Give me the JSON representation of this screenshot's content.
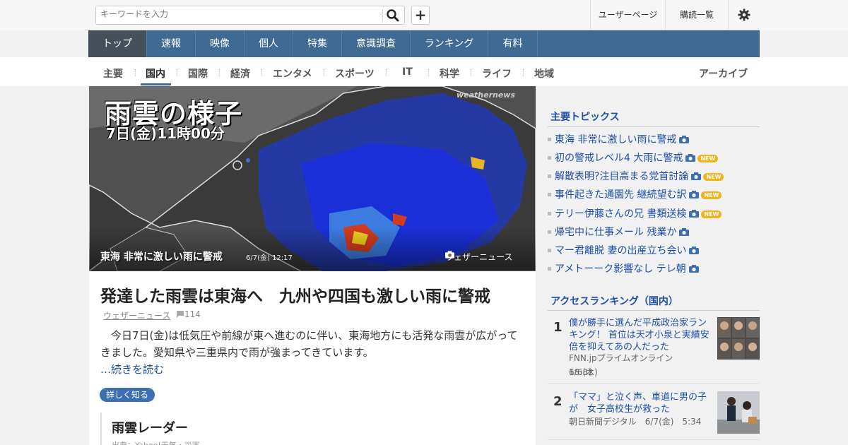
{
  "search": {
    "placeholder": "キーワードを入力",
    "add_label": "+"
  },
  "toplinks": {
    "user_page": "ユーザーページ",
    "subscriptions": "購読一覧"
  },
  "main_nav": [
    "トップ",
    "速報",
    "映像",
    "個人",
    "特集",
    "意識調査",
    "ランキング",
    "有料"
  ],
  "sub_nav": [
    "主要",
    "国内",
    "国際",
    "経済",
    "エンタメ",
    "スポーツ",
    "IT",
    "科学",
    "ライフ",
    "地域"
  ],
  "archive_label": "アーカイブ",
  "hero": {
    "image_title": "雨雲の様子",
    "image_subtitle": "7日(金)11時00分",
    "watermark": "weathernews",
    "caption": "東海 非常に激しい雨に警戒",
    "time": "6/7(金) 12:17",
    "credit": "ウェザーニュース"
  },
  "article": {
    "headline": "発達した雨雲は東海へ　九州や四国も激しい雨に警戒",
    "source": "ウェザーニュース",
    "comments": "114",
    "body_line1": "今日7日(金)は低気圧や前線が東へ進むのに伴い、東海地方にも活発な雨雲が広がって",
    "body_line2": "きました。愛知県や三重県内で雨が強まってきています。",
    "read_more": "…続きを読む",
    "learn_more": "詳しく知る",
    "radar_title": "雨雲レーダー",
    "radar_source": "出典：Yahoo!天気・災害"
  },
  "topics": {
    "title": "主要トピックス",
    "items": [
      {
        "text": "東海 非常に激しい雨に警戒",
        "new": false
      },
      {
        "text": "初の警戒レベル4 大雨に警戒",
        "new": true
      },
      {
        "text": "解散表明?注目高まる党首討論",
        "new": true
      },
      {
        "text": "事件起きた通園先 継続望む訳",
        "new": true
      },
      {
        "text": "テリー伊藤さんの兄 書類送検",
        "new": true
      },
      {
        "text": "帰宅中に仕事メール 残業か",
        "new": false
      },
      {
        "text": "マー君離脱 妻の出産立ち会い",
        "new": false
      },
      {
        "text": "アメトーーク影響なし テレ朝",
        "new": false
      }
    ],
    "new_label": "NEW"
  },
  "ranking": {
    "title": "アクセスランキング（国内）",
    "items": [
      {
        "rank": "1",
        "title": "僕が勝手に選んだ平成政治家ランキング！ 首位は天才小泉と実績安倍を抑えてあの人だった",
        "source": "FNN.jpプライムオンライン　6/6(木)",
        "time": "18:32"
      },
      {
        "rank": "2",
        "title": "「ママ」と泣く声、車道に男の子が　女子高校生が救った",
        "source": "朝日新聞デジタル　6/7(金)　5:34",
        "time": ""
      }
    ]
  },
  "colors": {
    "nav": "#3e6a93",
    "link": "#1d4fa8",
    "new_badge": "#f2b21a",
    "pill": "#3e6fb0"
  }
}
